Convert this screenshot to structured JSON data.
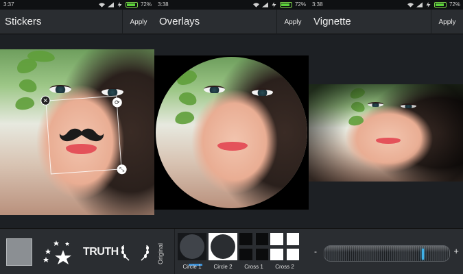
{
  "status_bars": [
    {
      "time": "3:37",
      "battery": "72%",
      "battery_level": 0.72
    },
    {
      "time": "3:38",
      "battery": "72%",
      "battery_level": 0.72
    },
    {
      "time": "3:38",
      "battery": "72%",
      "battery_level": 0.72
    }
  ],
  "panels": [
    {
      "title": "Stickers",
      "apply_label": "Apply"
    },
    {
      "title": "Overlays",
      "apply_label": "Apply"
    },
    {
      "title": "Vignette",
      "apply_label": "Apply"
    }
  ],
  "stickers": {
    "truth_label": "TRUTH",
    "items": [
      "blank-sticker",
      "stars-sticker",
      "truth-sticker",
      "wreath-sticker"
    ]
  },
  "overlays": {
    "original_tab": "Original",
    "items": [
      {
        "label": "Circle 1",
        "selected": true
      },
      {
        "label": "Circle 2",
        "selected": false
      },
      {
        "label": "Cross 1",
        "selected": false
      },
      {
        "label": "Cross 2",
        "selected": false
      }
    ]
  },
  "vignette": {
    "minus_label": "-",
    "plus_label": "+",
    "level": 0.79
  },
  "colors": {
    "accent": "#3a8fd6",
    "slider_knob": "#3fb1e8",
    "header_bg": "#2a2d31",
    "battery": "#5bd23a"
  }
}
